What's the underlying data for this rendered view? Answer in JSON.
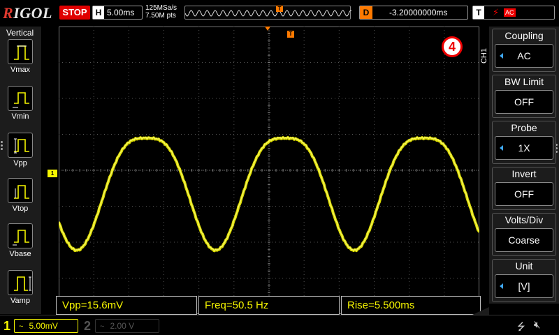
{
  "header": {
    "brand_prefix": "R",
    "brand_rest": "IGOL",
    "run_state": "STOP",
    "horizontal_label": "H",
    "timebase": "5.00ms",
    "sample_rate": "125MSa/s",
    "memory_points": "7.50M pts",
    "delay_label": "D",
    "delay_value": "-3.20000000ms",
    "trigger_label": "T",
    "trigger_edge": "f",
    "trigger_source": "AC"
  },
  "left_menu": {
    "title": "Vertical",
    "items": [
      {
        "label": "Vmax"
      },
      {
        "label": "Vmin"
      },
      {
        "label": "Vpp"
      },
      {
        "label": "Vtop"
      },
      {
        "label": "Vbase"
      },
      {
        "label": "Vamp"
      }
    ]
  },
  "display": {
    "channel_marker": "1",
    "trigger_marker": "T",
    "annotation_badge": "4"
  },
  "measurements": {
    "vpp": "Vpp=15.6mV",
    "freq": "Freq=50.5 Hz",
    "rise": "Rise=5.500ms"
  },
  "right_menu": {
    "channel_tab": "CH1",
    "items": [
      {
        "title": "Coupling",
        "value": "AC",
        "selectable": true
      },
      {
        "title": "BW Limit",
        "value": "OFF",
        "selectable": false
      },
      {
        "title": "Probe",
        "value": "1X",
        "selectable": true
      },
      {
        "title": "Invert",
        "value": "OFF",
        "selectable": false
      },
      {
        "title": "Volts/Div",
        "value": "Coarse",
        "selectable": false
      },
      {
        "title": "Unit",
        "value": "[V]",
        "selectable": true
      }
    ]
  },
  "channels": {
    "ch1": {
      "number": "1",
      "coupling_icon": "~",
      "scale": "5.00mV"
    },
    "ch2": {
      "number": "2",
      "coupling_icon": "~",
      "scale": "2.00 V"
    }
  },
  "icons": {
    "usb": "usb-icon",
    "speaker": "speaker-muted-icon"
  },
  "colors": {
    "ch1": "#f5f500",
    "trigger": "#ff7a00",
    "stop": "#e00000",
    "selector": "#3fa9f5"
  },
  "waveform": {
    "frequency_hz": 50.5,
    "vpp_mv": 15.6,
    "volts_per_div_mv": 5.0,
    "time_per_div_ms": 5.0,
    "shape": "rectified-sine-like"
  }
}
